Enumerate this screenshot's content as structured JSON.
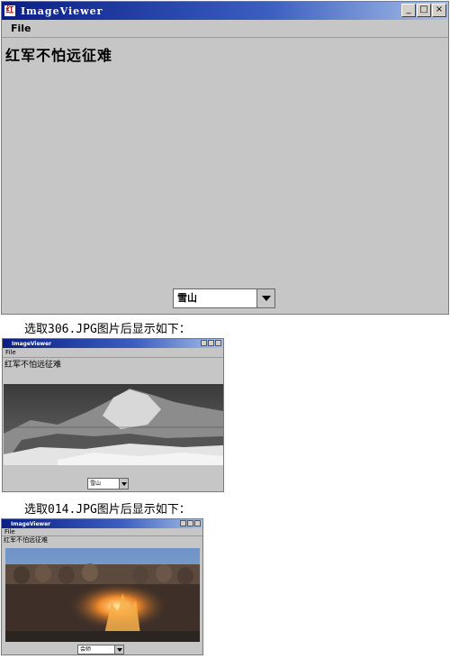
{
  "main_window": {
    "title": "ImageViewer",
    "icon_glyph": "红",
    "menu_file": "File",
    "heading": "红军不怕远征难",
    "combo_value": "雪山",
    "controls": [
      "_",
      "□",
      "×"
    ]
  },
  "captions": {
    "first": "选取306.JPG图片后显示如下：",
    "second": "选取014.JPG图片后显示如下："
  },
  "screenshot_306": {
    "title": "ImageViewer",
    "menu_file": "File",
    "heading": "红军不怕远征难",
    "combo_value": "雪山"
  },
  "screenshot_014": {
    "title": "ImageViewer",
    "menu_file": "File",
    "heading": "红军不怕远征难",
    "combo_value": "会师"
  },
  "colors": {
    "window_bg": "#c6c6c6",
    "titlebar_start": "#0a1e86",
    "titlebar_end": "#a8c0e8"
  }
}
